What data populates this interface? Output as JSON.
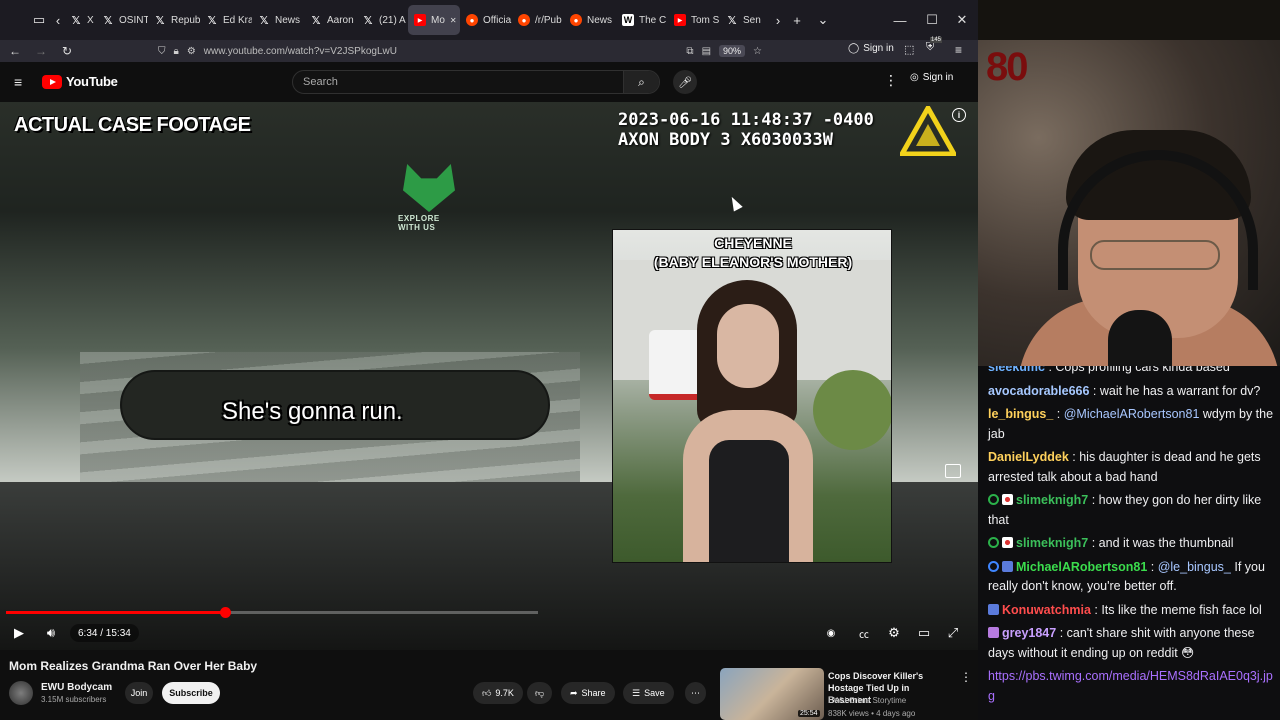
{
  "browser": {
    "tabs": [
      {
        "label": "X",
        "icon": "x-icon",
        "type": "x"
      },
      {
        "label": "OSINT",
        "icon": "x-icon",
        "type": "x"
      },
      {
        "label": "Repub",
        "icon": "x-icon",
        "type": "x"
      },
      {
        "label": "Ed Kra",
        "icon": "x-icon",
        "type": "x"
      },
      {
        "label": "News",
        "icon": "x-icon",
        "type": "x"
      },
      {
        "label": "Aaron",
        "icon": "x-icon",
        "type": "x"
      },
      {
        "label": "(21) A",
        "icon": "x-icon",
        "type": "x"
      },
      {
        "label": "Mo",
        "icon": "youtube-icon",
        "type": "yt"
      },
      {
        "label": "Officia",
        "icon": "reddit-icon",
        "type": "reddit"
      },
      {
        "label": "/r/Pub",
        "icon": "reddit-icon",
        "type": "reddit"
      },
      {
        "label": "News",
        "icon": "reddit-icon",
        "type": "reddit"
      },
      {
        "label": "The C",
        "icon": "wikipedia-icon",
        "type": "w"
      },
      {
        "label": "Tom S",
        "icon": "youtube-icon",
        "type": "yt"
      },
      {
        "label": "Sen",
        "icon": "x-icon",
        "type": "x"
      }
    ],
    "url": "www.youtube.com/watch?v=V2JSPkogLwU",
    "zoom": "90%",
    "sign_in": "Sign in",
    "notification_count": "145"
  },
  "youtube": {
    "logo_text": "YouTube",
    "search_placeholder": "Search",
    "sign_in": "Sign in"
  },
  "video": {
    "overlay_title": "ACTUAL CASE FOOTAGE",
    "timestamp_line1": "2023-06-16 11:48:37 -0400",
    "timestamp_line2": "AXON BODY 3 X6030033W",
    "watermark": "EXPLORE WITH US",
    "inset_caption_line1": "CHEYENNE",
    "inset_caption_line2": "(BABY ELEANOR'S MOTHER)",
    "subtitle": "She's gonna run.",
    "time_display": "6:34 / 15:34",
    "progress_fraction": 0.42,
    "title": "Mom Realizes Grandma Ran Over Her Baby"
  },
  "channel": {
    "name": "EWU Bodycam",
    "subscribers": "3.15M subscribers",
    "join_label": "Join",
    "subscribe_label": "Subscribe",
    "like_count": "9.7K",
    "share_label": "Share",
    "save_label": "Save"
  },
  "recommendation": {
    "title": "Cops Discover Killer's Hostage Tied Up in Basement",
    "channel": "EWU Crime Storytime",
    "meta": "838K views • 4 days ago",
    "duration": "25:54"
  },
  "stream": {
    "wall_sign": "80"
  },
  "chat": [
    {
      "user": "sleekumc",
      "color": "#6fb2ff",
      "badges": [],
      "text": "Cops profiling cars kinda based"
    },
    {
      "user": "avocadorable666",
      "color": "#a6c8ff",
      "badges": [],
      "text": "wait he has a warrant for dv?"
    },
    {
      "user": "le_bingus_",
      "color": "#ffd15c",
      "badges": [],
      "text": "@MichaelARobertson81 wdym by the jab",
      "mention": "@MichaelARobertson81",
      "rest": " wdym by the jab"
    },
    {
      "user": "DanielLyddek",
      "color": "#ffd15c",
      "badges": [],
      "text": "his daughter is dead and he gets arrested talk about a bad hand"
    },
    {
      "user": "slimeknigh7",
      "color": "#3bbf5a",
      "badges": [
        "green",
        "dots"
      ],
      "text": "how they gon do her dirty like that"
    },
    {
      "user": "slimeknigh7",
      "color": "#3bbf5a",
      "badges": [
        "green",
        "dots"
      ],
      "text": "and it was the thumbnail"
    },
    {
      "user": "MichaelARobertson81",
      "color": "#3bdc4d",
      "badges": [
        "blue",
        "sub"
      ],
      "text": "@le_bingus_ If you really don't know, you're better off.",
      "mention": "@le_bingus_",
      "rest": " If you really don't know, you're better off."
    },
    {
      "user": "Konuwatchmia",
      "color": "#ff4d4d",
      "badges": [
        "sub"
      ],
      "text": "Its like the meme fish face lol"
    },
    {
      "user": "grey1847",
      "color": "#c9a0ff",
      "badges": [
        "purple"
      ],
      "text": "can't share shit with anyone these days without it ending up on reddit 😳"
    },
    {
      "user": "",
      "color": "#a970ff",
      "badges": [],
      "text": "https://pbs.twimg.com/media/HEMS8dRaIAE0q3j.jpg",
      "is_link": true
    }
  ],
  "colors": {
    "yt_red": "#ff0000",
    "chat_bg": "#0e0e10",
    "link": "#a970ff"
  }
}
